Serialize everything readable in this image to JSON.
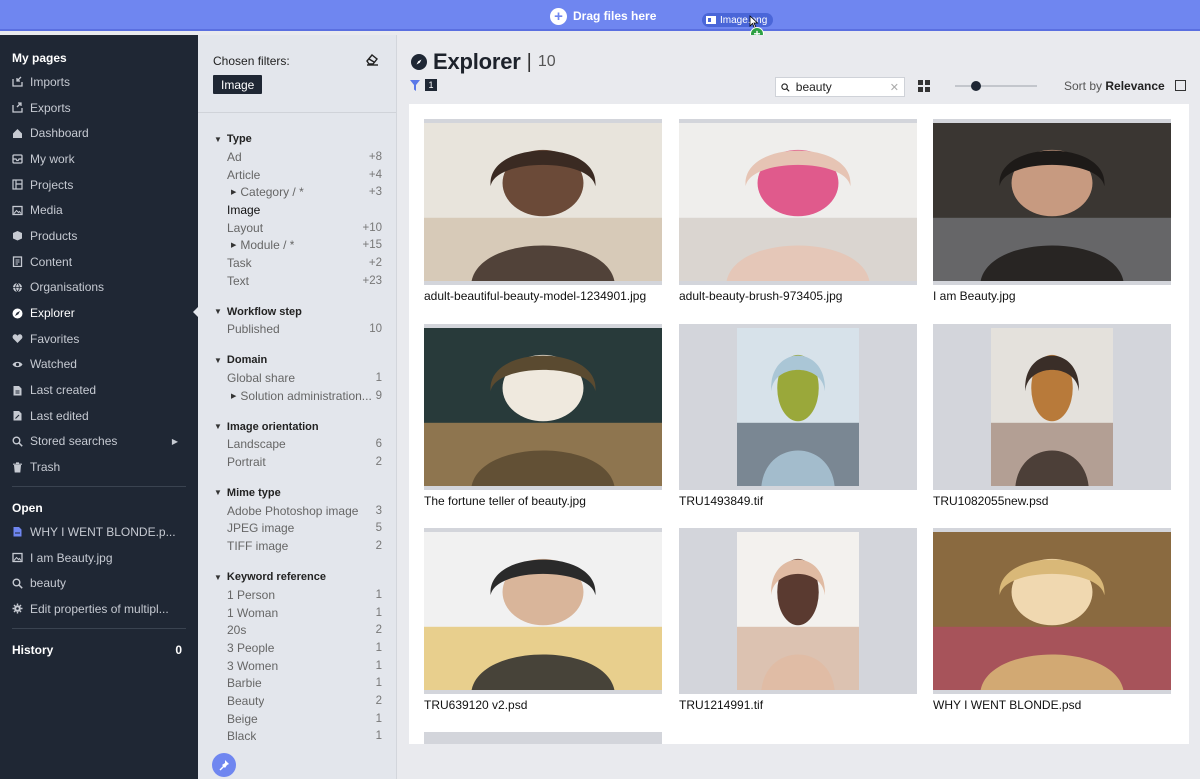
{
  "drop_banner": {
    "label": "Drag files here",
    "drag_chip": "Image.png"
  },
  "sidebar": {
    "my_pages_title": "My pages",
    "items": [
      {
        "label": "Imports",
        "icon": "import-icon"
      },
      {
        "label": "Exports",
        "icon": "export-icon"
      },
      {
        "label": "Dashboard",
        "icon": "home-icon"
      },
      {
        "label": "My work",
        "icon": "inbox-icon"
      },
      {
        "label": "Projects",
        "icon": "projects-icon"
      },
      {
        "label": "Media",
        "icon": "media-icon"
      },
      {
        "label": "Products",
        "icon": "box-icon"
      },
      {
        "label": "Content",
        "icon": "content-icon"
      },
      {
        "label": "Organisations",
        "icon": "globe-icon"
      },
      {
        "label": "Explorer",
        "icon": "compass-icon"
      },
      {
        "label": "Favorites",
        "icon": "heart-icon"
      },
      {
        "label": "Watched",
        "icon": "eye-icon"
      },
      {
        "label": "Last created",
        "icon": "doc-icon"
      },
      {
        "label": "Last edited",
        "icon": "edit-icon"
      },
      {
        "label": "Stored searches",
        "icon": "search-icon"
      },
      {
        "label": "Trash",
        "icon": "trash-icon"
      }
    ],
    "open_title": "Open",
    "open_items": [
      {
        "label": "WHY I WENT BLONDE.p...",
        "icon": "file-icon"
      },
      {
        "label": "I am Beauty.jpg",
        "icon": "image-icon"
      },
      {
        "label": "beauty",
        "icon": "search-icon"
      },
      {
        "label": "Edit properties of multipl...",
        "icon": "gear-icon"
      }
    ],
    "history_title": "History",
    "history_count": "0"
  },
  "filters": {
    "chosen_title": "Chosen filters:",
    "chosen": [
      "Image"
    ],
    "groups": [
      {
        "title": "Type",
        "rows": [
          {
            "label": "Ad",
            "count": "+8"
          },
          {
            "label": "Article",
            "count": "+4"
          },
          {
            "label": "Category / *",
            "count": "+3",
            "sub": true
          },
          {
            "label": "Image",
            "count": "",
            "selected": true
          },
          {
            "label": "Layout",
            "count": "+10"
          },
          {
            "label": "Module / *",
            "count": "+15",
            "sub": true
          },
          {
            "label": "Task",
            "count": "+2"
          },
          {
            "label": "Text",
            "count": "+23"
          }
        ]
      },
      {
        "title": "Workflow step",
        "rows": [
          {
            "label": "Published",
            "count": "10"
          }
        ]
      },
      {
        "title": "Domain",
        "rows": [
          {
            "label": "Global share",
            "count": "1"
          },
          {
            "label": "Solution administration...",
            "count": "9",
            "sub": true
          }
        ]
      },
      {
        "title": "Image orientation",
        "rows": [
          {
            "label": "Landscape",
            "count": "6"
          },
          {
            "label": "Portrait",
            "count": "2"
          }
        ]
      },
      {
        "title": "Mime type",
        "rows": [
          {
            "label": "Adobe Photoshop image",
            "count": "3"
          },
          {
            "label": "JPEG image",
            "count": "5"
          },
          {
            "label": "TIFF image",
            "count": "2"
          }
        ]
      },
      {
        "title": "Keyword reference",
        "rows": [
          {
            "label": "1 Person",
            "count": "1"
          },
          {
            "label": "1 Woman",
            "count": "1"
          },
          {
            "label": "20s",
            "count": "2"
          },
          {
            "label": "3 People",
            "count": "1"
          },
          {
            "label": "3 Women",
            "count": "1"
          },
          {
            "label": "Barbie",
            "count": "1"
          },
          {
            "label": "Beauty",
            "count": "2"
          },
          {
            "label": "Beige",
            "count": "1"
          },
          {
            "label": "Black",
            "count": "1"
          }
        ]
      }
    ]
  },
  "main": {
    "title": "Explorer",
    "separator": "|",
    "total": "10",
    "filter_count": "1",
    "search": {
      "value": "beauty",
      "placeholder": ""
    },
    "zoom_fraction": 0.22,
    "sort_prefix": "Sort by ",
    "sort_value": "Relevance",
    "results": [
      {
        "name": "adult-beautiful-beauty-model-1234901.jpg",
        "palette": [
          "#e8e4dc",
          "#3a2a22",
          "#6b4a38",
          "#c9b59a"
        ]
      },
      {
        "name": "adult-beauty-brush-973405.jpg",
        "palette": [
          "#efeeec",
          "#e6c4b4",
          "#e05a8c",
          "#c9c1b9"
        ]
      },
      {
        "name": "I am Beauty.jpg",
        "palette": [
          "#3a3632",
          "#1d1a18",
          "#c79a80",
          "#8a8e96"
        ]
      },
      {
        "name": "The fortune teller of beauty.jpg",
        "palette": [
          "#283a3a",
          "#5a4a30",
          "#efe9de",
          "#e2a560"
        ]
      },
      {
        "name": "TRU1493849.tif",
        "palette": [
          "#d7e2ea",
          "#aac6d6",
          "#9aa83a",
          "#2e3d4a"
        ]
      },
      {
        "name": "TRU1082055new.psd",
        "palette": [
          "#e4e1dc",
          "#3a2e28",
          "#b87a3a",
          "#8a6a5a"
        ]
      },
      {
        "name": "TRU639120 v2.psd",
        "palette": [
          "#f1f1f1",
          "#2a2a2a",
          "#d9b59a",
          "#e0b23a"
        ]
      },
      {
        "name": "TRU1214991.tif",
        "palette": [
          "#f3f1ee",
          "#e0bba3",
          "#5a3a30",
          "#c99a80"
        ]
      },
      {
        "name": "WHY I WENT BLONDE.psd",
        "palette": [
          "#8a6a40",
          "#d9b878",
          "#f0d8b0",
          "#c04070"
        ]
      }
    ]
  }
}
